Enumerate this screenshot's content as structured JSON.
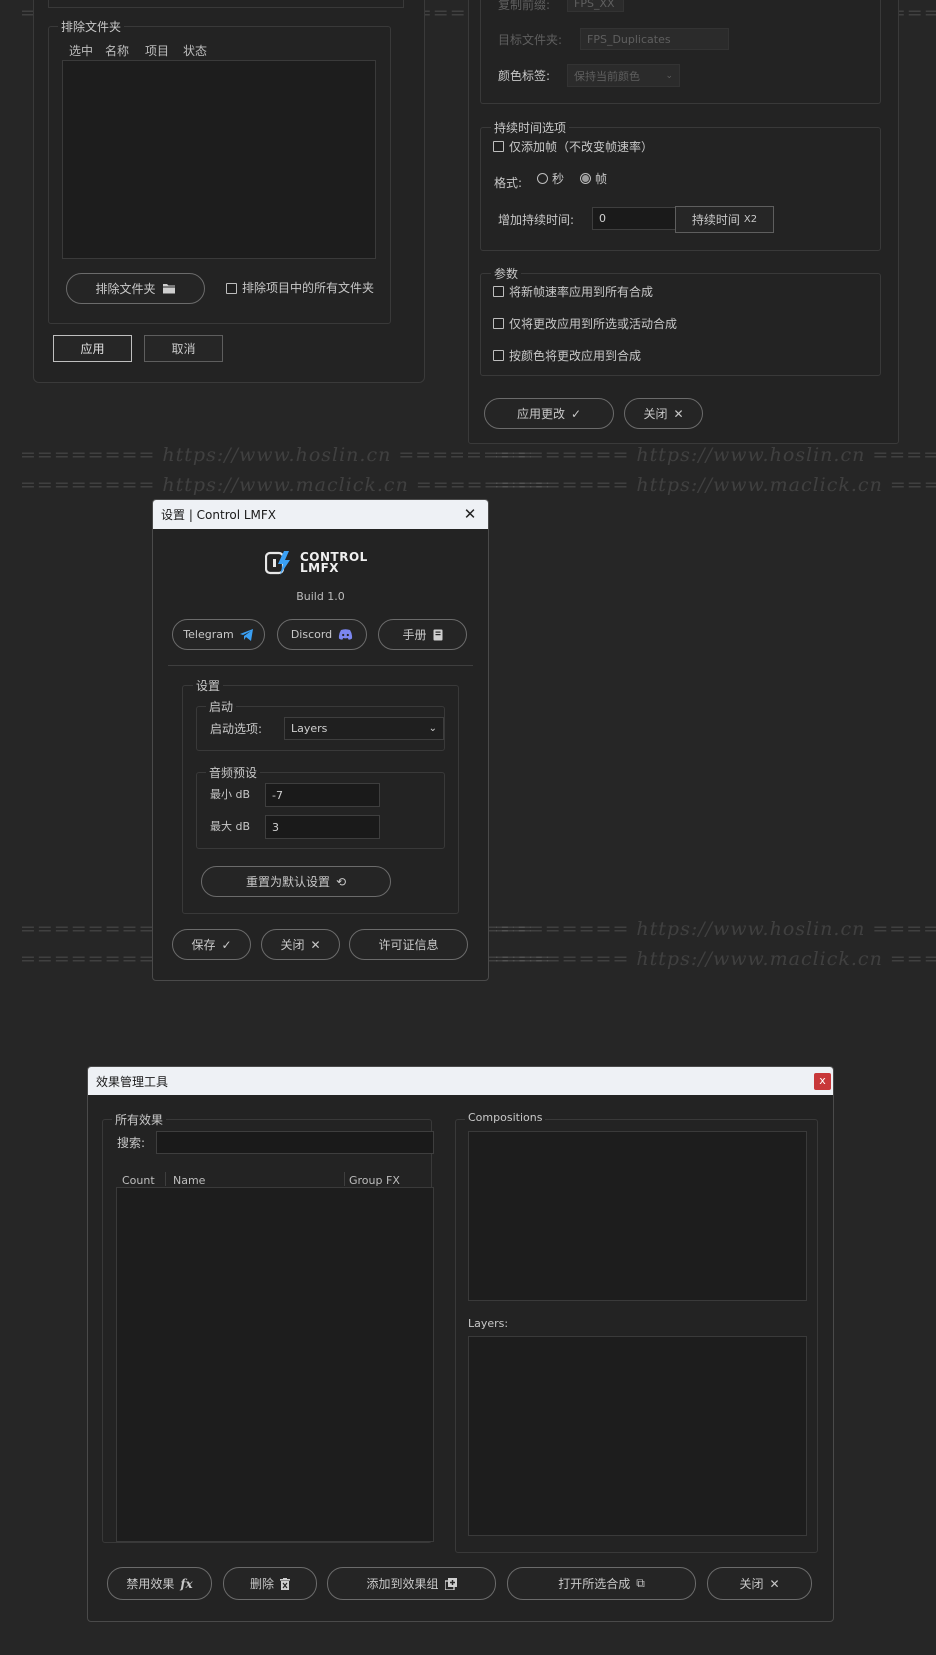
{
  "watermarks": {
    "maclick": "======== https://www.maclick.cn ========",
    "hoslin": "======== https://www.hoslin.cn ========"
  },
  "top_left_panel": {
    "exclude_group_title": "排除文件夹",
    "columns": [
      "选中",
      "名称",
      "项目",
      "状态"
    ],
    "exclude_folder_button": "排除文件夹",
    "exclude_all_checkbox": "排除项目中的所有文件夹",
    "apply_button": "应用",
    "cancel_button": "取消"
  },
  "top_right_panel": {
    "prefix_label": "复制前缀:",
    "prefix_value": "FPS_XX",
    "target_folder_label": "目标文件夹:",
    "target_folder_value": "FPS_Duplicates",
    "color_label": "颜色标签:",
    "color_value": "保持当前颜色",
    "duration_group_title": "持续时间选项",
    "add_frames_only": "仅添加帧（不改变帧速率）",
    "format_label": "格式:",
    "format_seconds": "秒",
    "format_frames": "帧",
    "add_duration_label": "增加持续时间:",
    "add_duration_value": "0",
    "duration_x2_button": "持续时间",
    "duration_x2_suffix": "X2",
    "params_group_title": "参数",
    "param1": "将新帧速率应用到所有合成",
    "param2": "仅将更改应用到所选或活动合成",
    "param3": "按颜色将更改应用到合成",
    "apply_changes_button": "应用更改",
    "close_button": "关闭"
  },
  "settings_dialog": {
    "title": "设置 | Control LMFX",
    "logo_line1": "CONTROL",
    "logo_line2": "LMFX",
    "build": "Build 1.0",
    "telegram": "Telegram",
    "discord": "Discord",
    "manual": "手册",
    "settings_group": "设置",
    "startup_group": "启动",
    "startup_label": "启动选项:",
    "startup_value": "Layers",
    "audio_group": "音频预设",
    "min_db_label": "最小 dB",
    "min_db_value": "-7",
    "max_db_label": "最大 dB",
    "max_db_value": "3",
    "reset_button": "重置为默认设置",
    "save_button": "保存",
    "close_button": "关闭",
    "license_button": "许可证信息"
  },
  "effects_dialog": {
    "title": "效果管理工具",
    "close_x": "x",
    "all_effects_group": "所有效果",
    "search_label": "搜索:",
    "search_value": "",
    "col_count": "Count",
    "col_name": "Name",
    "col_group_fx": "Group FX",
    "compositions_label": "Compositions",
    "layers_label": "Layers:",
    "disable_button": "禁用效果",
    "disable_suffix": "fx",
    "delete_button": "删除",
    "add_group_button": "添加到效果组",
    "open_comp_button": "打开所选合成",
    "close_button": "关闭"
  }
}
